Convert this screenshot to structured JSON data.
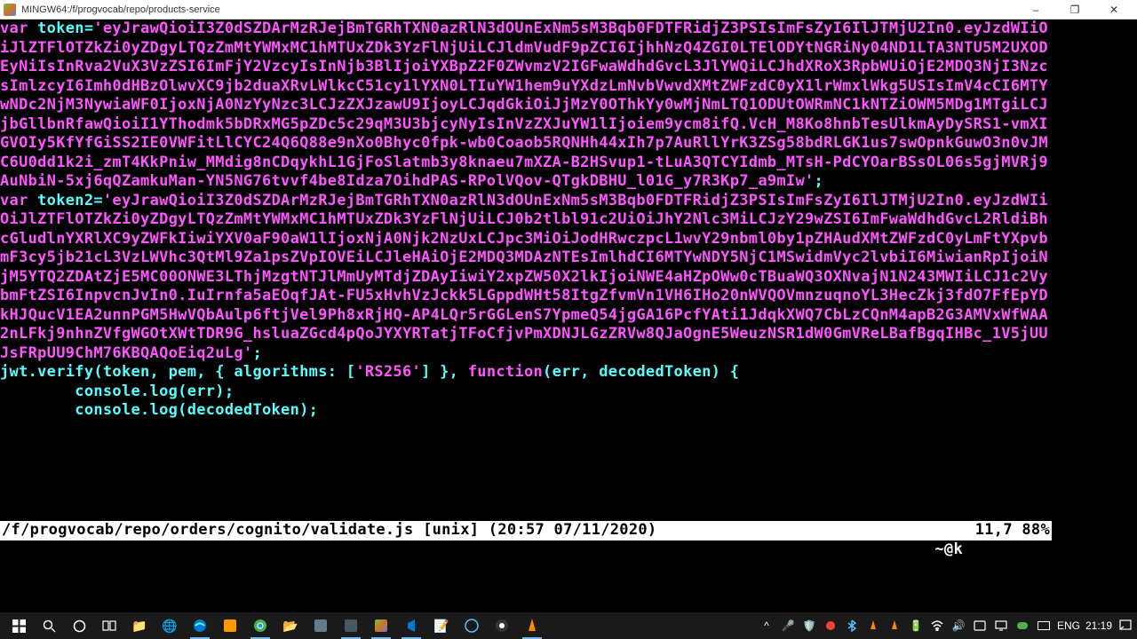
{
  "window": {
    "title": "MINGW64:/f/progvocab/repo/products-service",
    "minimize": "–",
    "maximize": "❐",
    "close": "✕"
  },
  "code": {
    "var_kw": "var",
    "token_name": " token=",
    "token_str": "'eyJrawQioiI3Z0dSZDArMzRJejBmTGRhTXN0azRlN3dOUnExNm5sM3Bqb0FDTFRidjZ3PSIsImFsZyI6IlJTMjU2In0.eyJzdWIiOiJlZTFlOTZkZi0yZDgyLTQzZmMtYWMxMC1hMTUxZDk3YzFlNjUiLCJldmVudF9pZCI6IjhhNzQ4ZGI0LTElODYtNGRiNy04ND1LTA3NTU5M2UXODEyNiIsInRva2VuX3VzZSI6ImFjY2VzcyIsInNjb3BlIjoiYXBpZ2F0ZWvmzV2IGFwaWdhdGvcL3JlYWQiLCJhdXRoX3RpbWUiOjE2MDQ3NjI3NzcsImlzcyI6Imh0dHBzOlwvXC9jb2duaXRvLWlkcC51cy1lYXN0LTIuYW1hem9uYXdzLmNvbVwvdXMtZWFzdC0yX1lrWmxlWkg5USIsImV4cCI6MTYwNDc2NjM3NywiaWF0IjoxNjA0NzYyNzc3LCJzZXJzawU9IjoyLCJqdGkiOiJjMzY0OThkYy0wMjNmLTQ1ODUtOWRmNC1kNTZiOWM5MDg1MTgiLCJjbGllbnRfawQioiI1YThodmk5bDRxMG5pZDc5c29qM3U3bjcyNyIsInVzZXJuYW1lIjoiem9ycm8ifQ.VcH_M8Ko8hnbTesUlkmAyDySRS1-vmXIGVOIy5KfYfGiSS2IE0VWFitLlCYC24Q6Q88e9nXo0Bhyc0fpk-wb0Coaob5RQNHh44xIh7p7AuRllYrK3ZSg58bdRLGK1us7swOpnkGuwO3n0vJMC6U0dd1k2i_zmT4KkPniw_MMdig8nCDqykhL1GjFoSlatmb3y8knaeu7mXZA-B2HSvup1-tLuA3QTCYIdmb_MTsH-PdCYOarBSsOL06s5gjMVRj9AuNbiN-5xj6qQZamkuMan-YN5NG76tvvf4be8Idza7OihdPAS-RPolVQov-QTgkDBHU_l01G_y7R3Kp7_a9mIw'",
    "semi1": ";",
    "token2_name": " token2=",
    "token2_str": "'eyJrawQioiI3Z0dSZDArMzRJejBmTGRhTXN0azRlN3dOUnExNm5sM3Bqb0FDTFRidjZ3PSIsImFsZyI6IlJTMjU2In0.eyJzdWIiOiJlZTFlOTZkZi0yZDgyLTQzZmMtYWMxMC1hMTUxZDk3YzFlNjUiLCJ0b2tlbl91c2UiOiJhY2Nlc3MiLCJzY29wZSI6ImFwaWdhdGvcL2RldiBhcGludlnYXRlXC9yZWFkIiwiYXV0aF90aW1lIjoxNjA0Njk2NzUxLCJpc3MiOiJodHRwczpcL1wvY29nbml0by1pZHAudXMtZWFzdC0yLmFtYXpvbmF3cy5jb21cL3VzLWVhc3QtMl9Za1psZVpIOVEiLCJleHAiOjE2MDQ3MDAzNTEsImlhdCI6MTYwNDY5NjC1MSwidmVyc2lvbiI6MiwianRpIjoiNjM5YTQ2ZDAtZjE5MC00ONWE3LThjMzgtNTJlMmUyMTdjZDAyIiwiY2xpZW50X2lkIjoiNWE4aHZpOWw0cTBuaWQ3OXNvajN1N243MWIiLCJ1c2VybmFtZSI6InpvcnJvIn0.IuIrnfa5aEOqfJAt-FU5xHvhVzJckk5LGppdWHt58ItgZfvmVn1VH6IHo20nWVQOVmnzuqnoYL3HecZkj3fdO7FfEpYDkHJQucV1EA2unnPGM5HwVQbAulp6ftjVel9Ph8xRjHQ-AP4LQr5rGGLenS7YpmeQ54jgGA16PcfYAti1JdqkXWQ7CbLzCQnM4apB2G3AMVxWfWAA2nLFkj9nhnZVfgWGOtXWtTDR9G_hsluaZGcd4pQoJYXYRTatjTFoCfjvPmXDNJLGzZRVw8QJaOgnE5WeuzNSR1dW0GmVReLBafBgqIHBc_1V5jUUJsFRpUU9ChM76KBQAQoEiq2uLg'",
    "semi2": ";",
    "verify_call": "jwt.verify(token, pem, { algorithms: [",
    "rs256": "'RS256'",
    "verify_mid": "] }, ",
    "fn_kw": "function",
    "fn_args": "(err, decodedToken) {",
    "log_err": "        console.log(err);",
    "log_tok": "        console.log(decodedToken);"
  },
  "status": {
    "left": "/f/progvocab/repo/orders/cognito/validate.js [unix] (20:57 07/11/2020)",
    "right": "11,7 88%"
  },
  "cmdline": "~@k",
  "tray": {
    "lang": "ENG",
    "time": "21:19"
  }
}
